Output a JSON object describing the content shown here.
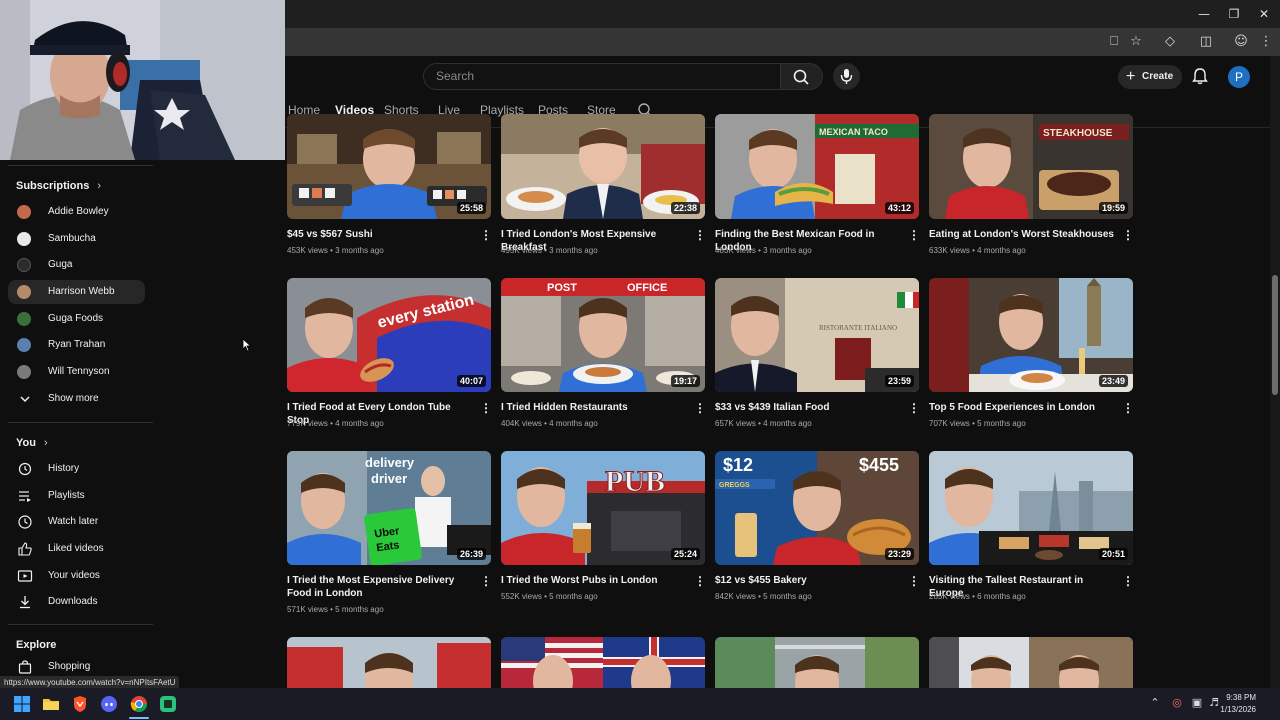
{
  "browser": {
    "status_url": "https://www.youtube.com/watch?v=nNPItsFAetU"
  },
  "header": {
    "search_placeholder": "Search",
    "create_label": "Create",
    "avatar_letter": "P"
  },
  "tabs": [
    {
      "label": "Home"
    },
    {
      "label": "Videos"
    },
    {
      "label": "Shorts"
    },
    {
      "label": "Live"
    },
    {
      "label": "Playlists"
    },
    {
      "label": "Posts"
    },
    {
      "label": "Store"
    }
  ],
  "sidebar": {
    "subscriptions_heading": "Subscriptions",
    "subscriptions": [
      {
        "label": "Addie Bowley",
        "color": "#c06a4a"
      },
      {
        "label": "Sambucha",
        "color": "#e8e8e8"
      },
      {
        "label": "Guga",
        "color": "#2b2b2b"
      },
      {
        "label": "Harrison Webb",
        "color": "#b58a6a"
      },
      {
        "label": "Guga Foods",
        "color": "#3a6e3a"
      },
      {
        "label": "Ryan Trahan",
        "color": "#5a7fb0"
      },
      {
        "label": "Will Tennyson",
        "color": "#7a7a7a"
      }
    ],
    "show_more": "Show more",
    "you_heading": "You",
    "you_items": [
      {
        "label": "History",
        "icon": "history-icon"
      },
      {
        "label": "Playlists",
        "icon": "playlists-icon"
      },
      {
        "label": "Watch later",
        "icon": "clock-icon"
      },
      {
        "label": "Liked videos",
        "icon": "thumbs-up-icon"
      },
      {
        "label": "Your videos",
        "icon": "video-icon"
      },
      {
        "label": "Downloads",
        "icon": "download-icon"
      }
    ],
    "explore_heading": "Explore",
    "explore_items": [
      {
        "label": "Shopping",
        "icon": "shopping-bag-icon"
      }
    ]
  },
  "videos": [
    {
      "title": "$45 vs $567 Sushi",
      "views": "453K views",
      "age": "3 months ago",
      "duration": "25:58"
    },
    {
      "title": "I Tried London's Most Expensive Breakfast",
      "views": "495K views",
      "age": "3 months ago",
      "duration": "22:38"
    },
    {
      "title": "Finding the Best Mexican Food in London",
      "views": "483K views",
      "age": "3 months ago",
      "duration": "43:12"
    },
    {
      "title": "Eating at London's Worst Steakhouses",
      "views": "633K views",
      "age": "4 months ago",
      "duration": "19:59"
    },
    {
      "title": "I Tried Food at Every London Tube Stop",
      "views": "779K views",
      "age": "4 months ago",
      "duration": "40:07"
    },
    {
      "title": "I Tried Hidden Restaurants",
      "views": "404K views",
      "age": "4 months ago",
      "duration": "19:17"
    },
    {
      "title": "$33 vs $439 Italian Food",
      "views": "657K views",
      "age": "4 months ago",
      "duration": "23:59"
    },
    {
      "title": "Top 5 Food Experiences in London",
      "views": "707K views",
      "age": "5 months ago",
      "duration": "23:49"
    },
    {
      "title": "I Tried the Most Expensive Delivery Food in London",
      "views": "571K views",
      "age": "5 months ago",
      "duration": "26:39"
    },
    {
      "title": "I Tried the Worst Pubs in London",
      "views": "552K views",
      "age": "5 months ago",
      "duration": "25:24"
    },
    {
      "title": "$12 vs $455 Bakery",
      "views": "842K views",
      "age": "5 months ago",
      "duration": "23:29"
    },
    {
      "title": "Visiting the Tallest Restaurant in Europe",
      "views": "265K views",
      "age": "6 months ago",
      "duration": "20:51"
    }
  ],
  "thumb_text": {
    "t0": "",
    "t2": "MEXICAN TACO",
    "t3": "STEAKHOUSE",
    "t4": "every station",
    "t5_a": "POST",
    "t5_b": "OFFICE",
    "t6": "RISTORANTE ITALIANO",
    "t8_a": "delivery",
    "t8_b": "driver",
    "t8_c": "Uber",
    "t8_d": "Eats",
    "t9": "PUB",
    "t10_a": "$12",
    "t10_b": "$455",
    "t10_c": "GREGGS"
  },
  "taskbar": {
    "time": "9:38 PM",
    "date": "1/13/2026"
  }
}
